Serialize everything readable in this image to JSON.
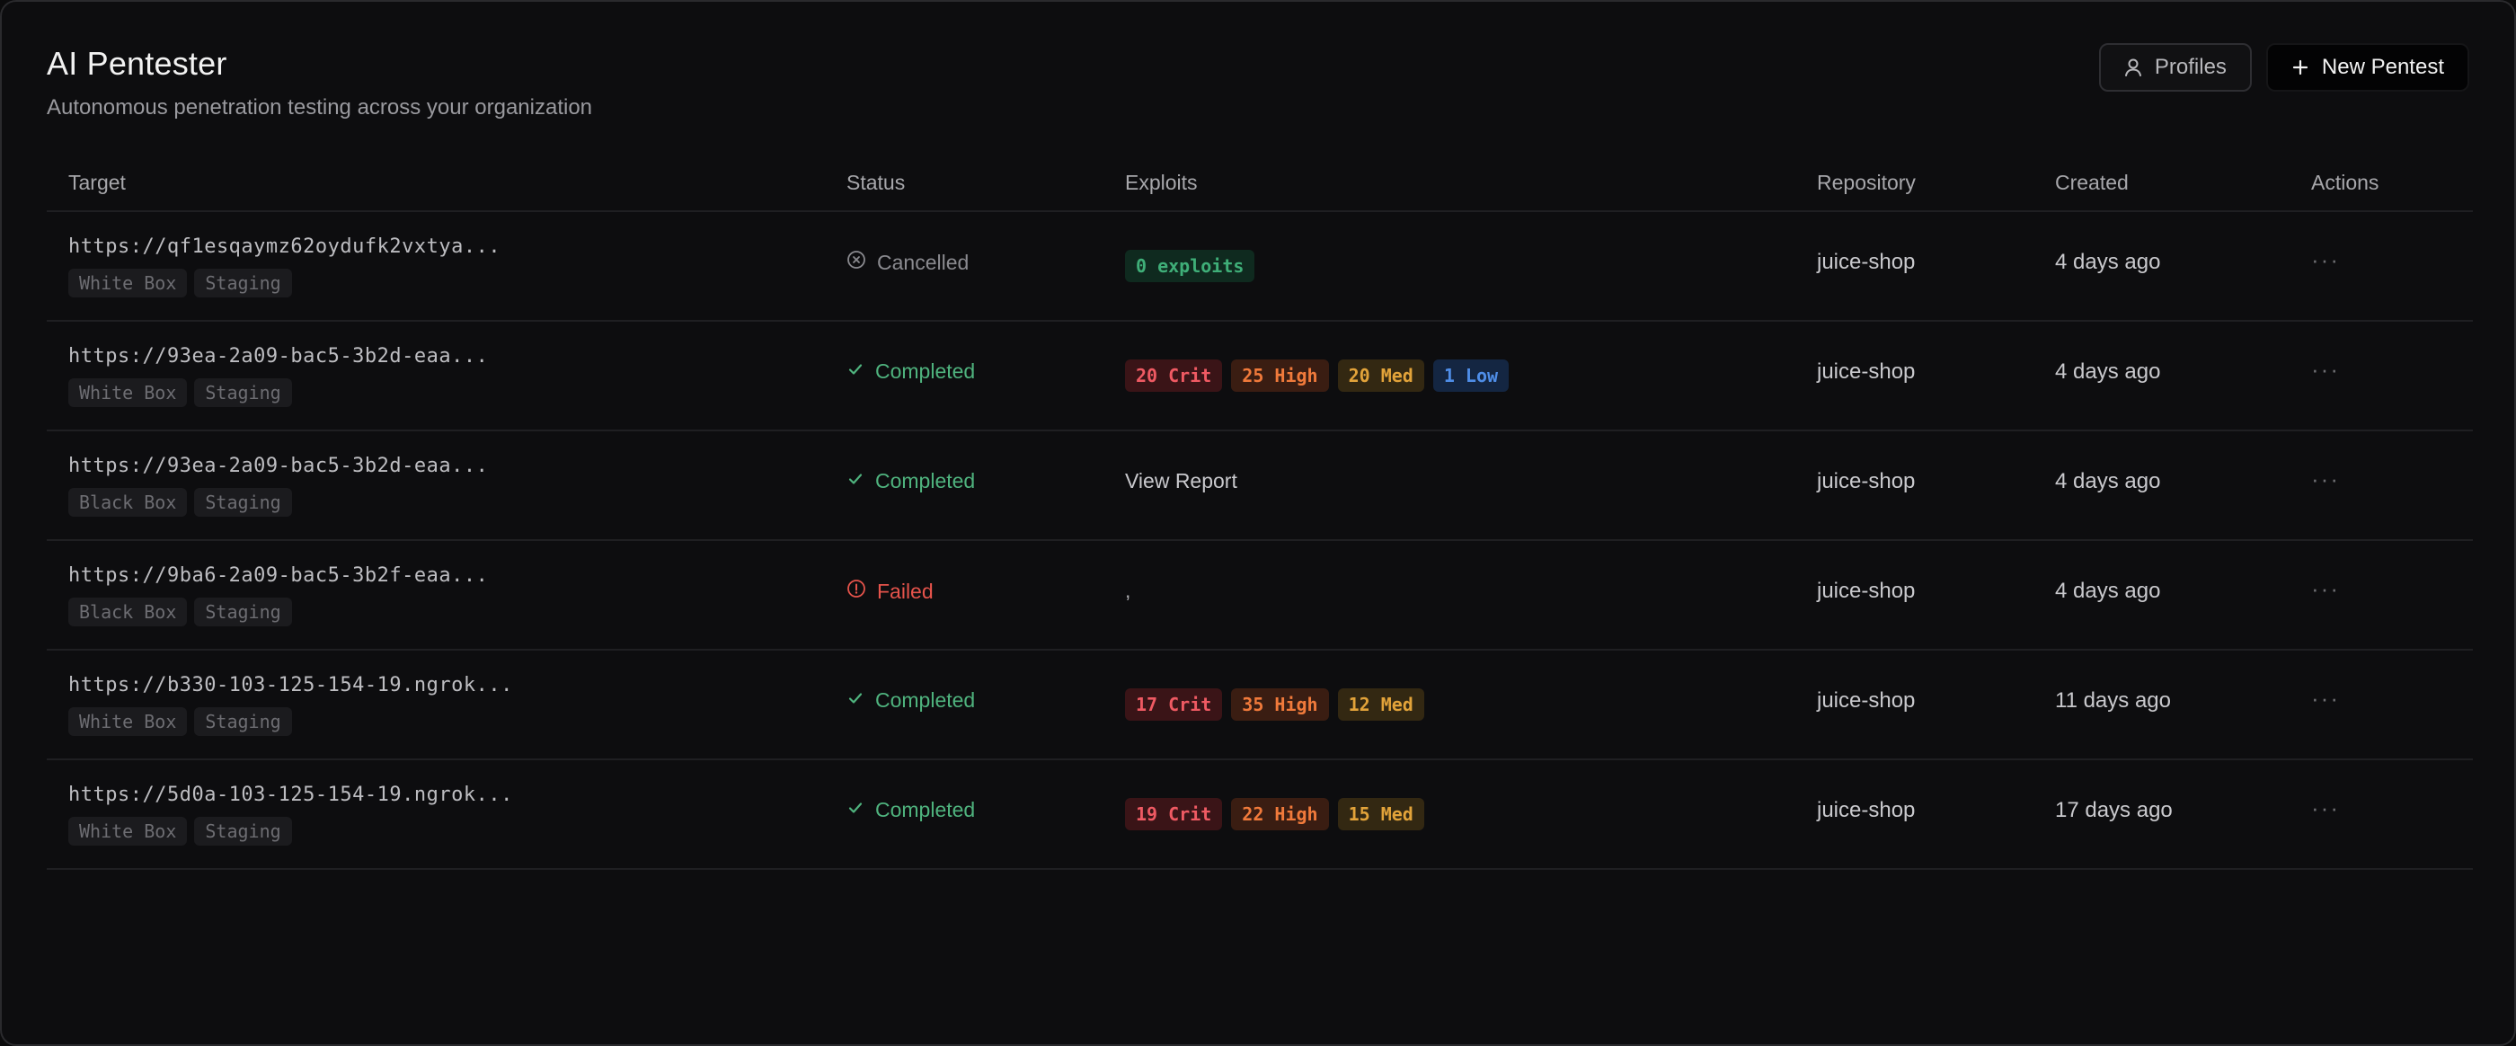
{
  "header": {
    "title": "AI Pentester",
    "subtitle": "Autonomous penetration testing across your organization"
  },
  "toolbar": {
    "profiles_label": "Profiles",
    "new_label": "New Pentest"
  },
  "table": {
    "columns": [
      "Target",
      "Status",
      "Exploits",
      "Repository",
      "Created",
      "Actions"
    ],
    "rows": [
      {
        "target": "https://qf1esqaymz62oydufk2vxtya...",
        "tags": [
          "White Box",
          "Staging"
        ],
        "status": "Cancelled",
        "exploits": {
          "kind": "zero",
          "badges": [
            "0 exploits"
          ]
        },
        "repository": "juice-shop",
        "created": "4 days ago",
        "actions": "···"
      },
      {
        "target": "https://93ea-2a09-bac5-3b2d-eaa...",
        "tags": [
          "White Box",
          "Staging"
        ],
        "status": "Completed",
        "exploits": {
          "kind": "badges",
          "badges": [
            "20 Crit",
            "25 High",
            "20 Med",
            "1 Low"
          ]
        },
        "repository": "juice-shop",
        "created": "4 days ago",
        "actions": "···"
      },
      {
        "target": "https://93ea-2a09-bac5-3b2d-eaa...",
        "tags": [
          "Black Box",
          "Staging"
        ],
        "status": "Completed",
        "exploits": {
          "kind": "report",
          "text": "View Report"
        },
        "repository": "juice-shop",
        "created": "4 days ago",
        "actions": "···"
      },
      {
        "target": "https://9ba6-2a09-bac5-3b2f-eaa...",
        "tags": [
          "Black Box",
          "Staging"
        ],
        "status": "Failed",
        "exploits": {
          "kind": "dash",
          "text": ","
        },
        "repository": "juice-shop",
        "created": "4 days ago",
        "actions": "···"
      },
      {
        "target": "https://b330-103-125-154-19.ngrok...",
        "tags": [
          "White Box",
          "Staging"
        ],
        "status": "Completed",
        "exploits": {
          "kind": "badges",
          "badges": [
            "17 Crit",
            "35 High",
            "12 Med"
          ]
        },
        "repository": "juice-shop",
        "created": "11 days ago",
        "actions": "···"
      },
      {
        "target": "https://5d0a-103-125-154-19.ngrok...",
        "tags": [
          "White Box",
          "Staging"
        ],
        "status": "Completed",
        "exploits": {
          "kind": "badges",
          "badges": [
            "19 Crit",
            "22 High",
            "15 Med"
          ]
        },
        "repository": "juice-shop",
        "created": "17 days ago",
        "actions": "···"
      }
    ]
  },
  "colors": {
    "completed": "#4fb37e",
    "cancelled": "#8a8a8f",
    "failed": "#e5534b"
  },
  "icons": {
    "profiles": "user-icon",
    "new": "plus-icon",
    "completed": "check-icon",
    "cancelled": "x-circle-icon",
    "failed": "alert-circle-icon",
    "actions": "more-icon"
  }
}
